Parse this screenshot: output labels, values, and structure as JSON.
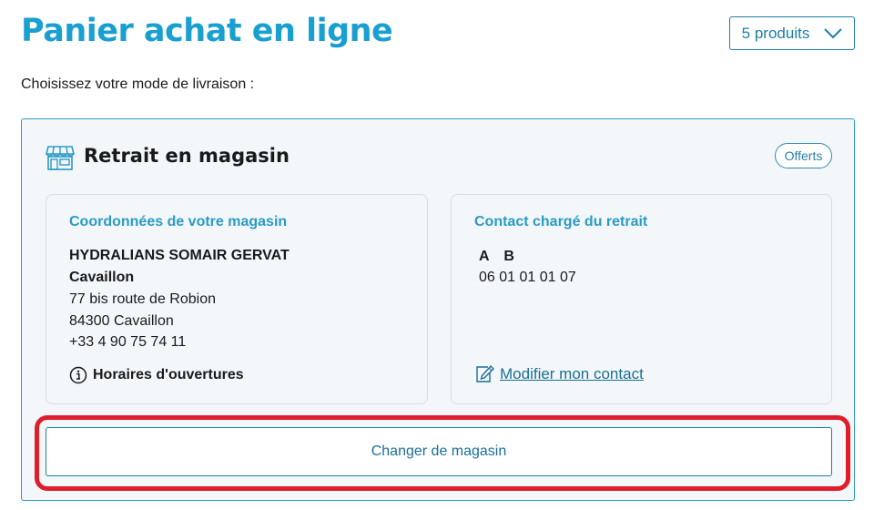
{
  "header": {
    "title": "Panier achat en ligne",
    "products_dropdown": {
      "label": "5 produits",
      "icon": "chevron-down-icon"
    }
  },
  "instruction": "Choisissez votre mode de livraison :",
  "delivery_option": {
    "title": "Retrait en magasin",
    "icon": "storefront-icon",
    "badge": "Offerts",
    "store": {
      "heading": "Coordonnées de votre magasin",
      "name": "HYDRALIANS SOMAIR GERVAT",
      "city_label": "Cavaillon",
      "address": "77 bis route de Robion",
      "postal_city": "84300 Cavaillon",
      "phone": "+33 4 90 75 74 11",
      "hours_link": "Horaires d'ouvertures",
      "hours_icon": "info-icon"
    },
    "contact": {
      "heading": "Contact chargé du retrait",
      "name": "A B",
      "phone": "06 01 01 01 07",
      "edit_link": "Modifier mon contact",
      "edit_icon": "pencil-icon"
    },
    "change_store_button": "Changer de magasin"
  },
  "colors": {
    "brand_blue": "#1aa0d0",
    "link_blue": "#1a6f96",
    "highlight_red": "#e01d2a"
  }
}
